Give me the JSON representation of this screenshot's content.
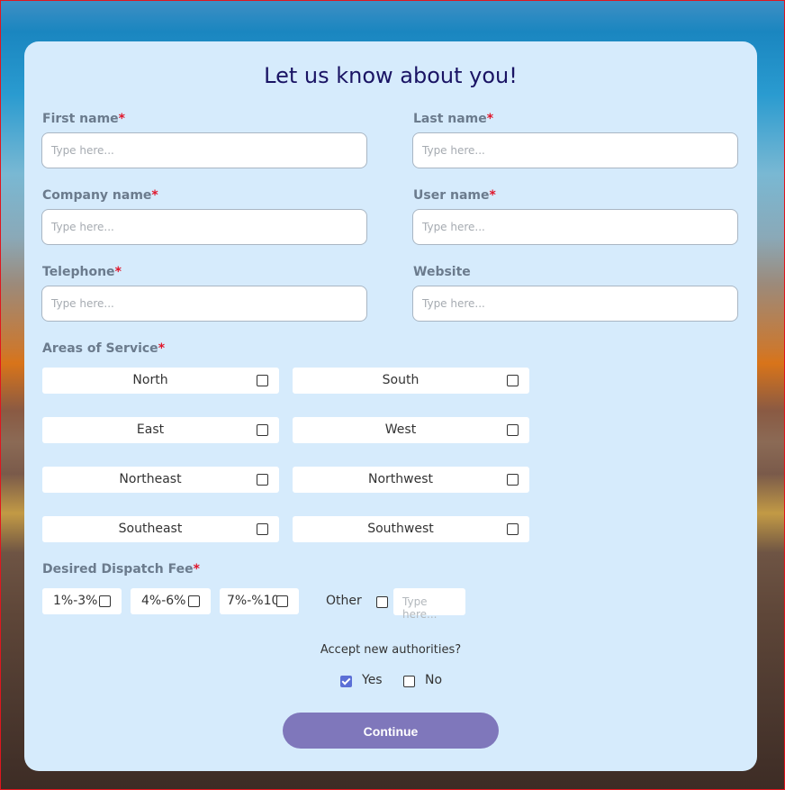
{
  "form": {
    "title": "Let us know about you!",
    "required_mark": "*",
    "fields": {
      "first_name": {
        "label": "First name",
        "placeholder": "Type here..."
      },
      "last_name": {
        "label": "Last name",
        "placeholder": "Type here..."
      },
      "company_name": {
        "label": "Company name",
        "placeholder": "Type here..."
      },
      "user_name": {
        "label": "User name",
        "placeholder": "Type here..."
      },
      "telephone": {
        "label": "Telephone",
        "placeholder": "Type here..."
      },
      "website": {
        "label": "Website",
        "placeholder": "Type here..."
      }
    },
    "areas": {
      "label": "Areas of Service",
      "items": [
        "North",
        "South",
        "East",
        "West",
        "Northeast",
        "Northwest",
        "Southeast",
        "Southwest"
      ]
    },
    "fee": {
      "label": "Desired Dispatch Fee",
      "options": [
        "1%-3%",
        "4%-6%",
        "7%-%10"
      ],
      "other_label": "Other",
      "other_placeholder": "Type here..."
    },
    "authorities": {
      "question": "Accept new authorities?",
      "yes": "Yes",
      "no": "No",
      "selected": "Yes"
    },
    "continue_label": "Continue"
  },
  "colors": {
    "card_bg": "#d6ebfc",
    "title": "#1a1464",
    "required": "#e0162b",
    "button": "#7f77bb",
    "checkbox_checked": "#5b6fd6"
  }
}
